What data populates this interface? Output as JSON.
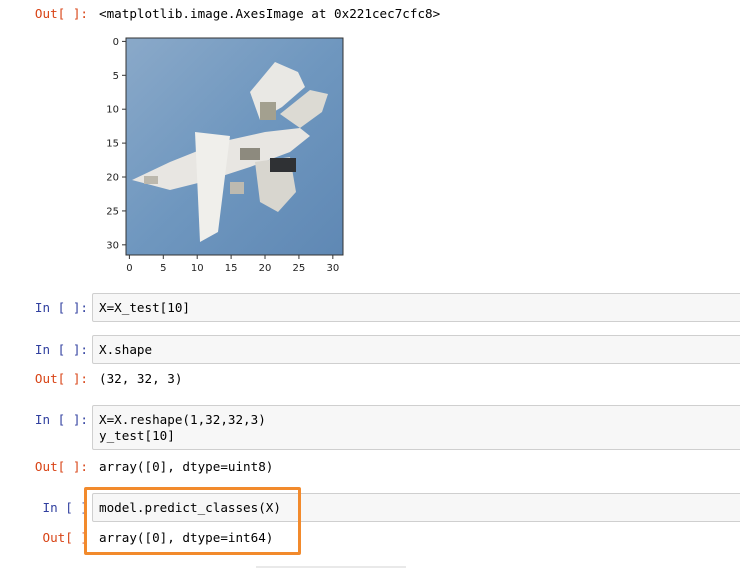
{
  "cells": [
    {
      "prompt": "Out[ ]:",
      "text": "<matplotlib.image.AxesImage at 0x221cec7cfc8>"
    },
    {
      "prompt": "In [ ]:",
      "code": "X=X_test[10]"
    },
    {
      "prompt": "In [ ]:",
      "code": "X.shape"
    },
    {
      "prompt": "Out[ ]:",
      "text": "(32, 32, 3)"
    },
    {
      "prompt": "In [ ]:",
      "code": "X=X.reshape(1,32,32,3)\ny_test[10]"
    },
    {
      "prompt": "Out[ ]:",
      "text": "array([0], dtype=uint8)"
    },
    {
      "prompt": "In [ ]",
      "code": "model.predict_classes(X)"
    },
    {
      "prompt": "Out[ ]",
      "text": "array([0], dtype=int64)"
    }
  ],
  "plot": {
    "yticks": [
      "0",
      "5",
      "10",
      "15",
      "20",
      "25",
      "30"
    ],
    "xticks": [
      "0",
      "5",
      "10",
      "15",
      "20",
      "25",
      "30"
    ],
    "image_subject": "airplane-image",
    "sky_color": "#6f97bf",
    "highlight_color": "#f28a2c"
  }
}
